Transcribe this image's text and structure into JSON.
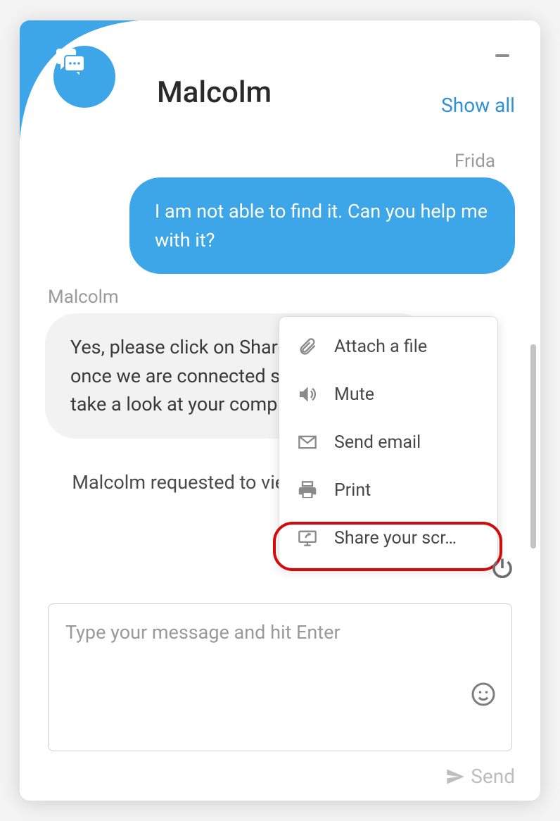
{
  "header": {
    "title": "Malcolm",
    "show_all": "Show all"
  },
  "conversation": {
    "sender_out": "Frida",
    "msg_out": "I am not able to find it. Can you help me with it?",
    "sender_in": "Malcolm",
    "msg_in": "Yes, please click on Share Your Screen once we are connected so that I can take a look at your computer screen.",
    "system": "Malcolm requested to view your computer screen"
  },
  "menu": {
    "attach": "Attach a file",
    "mute": "Mute",
    "email": "Send email",
    "print": "Print",
    "share": "Share your scr…"
  },
  "input": {
    "placeholder": "Type your message and hit Enter"
  },
  "send_label": "Send"
}
